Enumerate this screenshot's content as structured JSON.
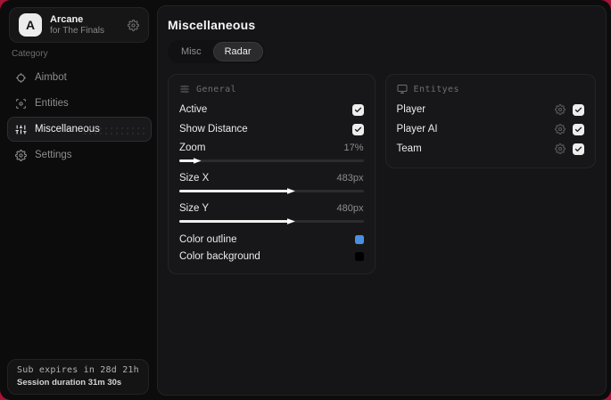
{
  "app": {
    "logo_letter": "A",
    "name": "Arcane",
    "subtitle": "for The Finals"
  },
  "sidebar": {
    "category_label": "Category",
    "items": [
      {
        "label": "Aimbot",
        "icon": "crosshair-icon",
        "active": false
      },
      {
        "label": "Entities",
        "icon": "scan-icon",
        "active": false
      },
      {
        "label": "Miscellaneous",
        "icon": "sliders-icon",
        "active": true
      },
      {
        "label": "Settings",
        "icon": "gear-icon",
        "active": false
      }
    ],
    "footer": {
      "line1": "Sub expires in 28d 21h",
      "line2": "Session duration 31m 30s"
    }
  },
  "main": {
    "title": "Miscellaneous",
    "tabs": [
      {
        "label": "Misc",
        "active": false
      },
      {
        "label": "Radar",
        "active": true
      }
    ],
    "general": {
      "header": "General",
      "toggles": [
        {
          "label": "Active",
          "checked": true
        },
        {
          "label": "Show Distance",
          "checked": true
        }
      ],
      "sliders": [
        {
          "label": "Zoom",
          "value": "17%",
          "percent": 8
        },
        {
          "label": "Size X",
          "value": "483px",
          "percent": 59
        },
        {
          "label": "Size Y",
          "value": "480px",
          "percent": 59
        }
      ],
      "colors": [
        {
          "label": "Color outline",
          "color": "#4a90e2"
        },
        {
          "label": "Color background",
          "color": "#000000"
        }
      ]
    },
    "entities": {
      "header": "Entityes",
      "rows": [
        {
          "label": "Player",
          "checked": true
        },
        {
          "label": "Player AI",
          "checked": true
        },
        {
          "label": "Team",
          "checked": true
        }
      ]
    }
  },
  "theme": {
    "backdrop_red": "#a61438",
    "window_bg": "#0c0c0d",
    "panel_bg": "#17171a",
    "accent_blue": "#4a90e2"
  }
}
